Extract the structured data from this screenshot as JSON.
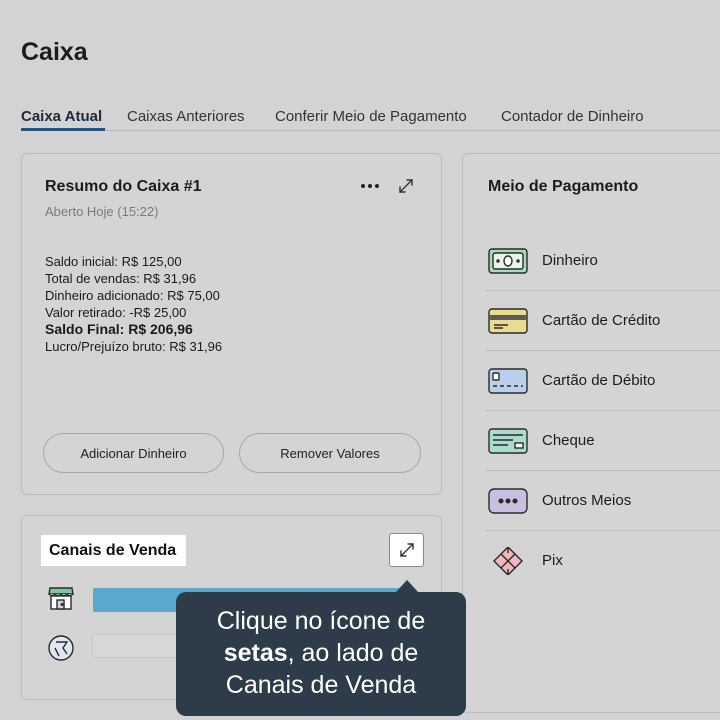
{
  "page": {
    "title": "Caixa"
  },
  "tabs": [
    {
      "label": "Caixa Atual",
      "active": true
    },
    {
      "label": "Caixas Anteriores",
      "active": false
    },
    {
      "label": "Conferir Meio de Pagamento",
      "active": false
    },
    {
      "label": "Contador de Dinheiro",
      "active": false
    }
  ],
  "resumo": {
    "title": "Resumo do Caixa #1",
    "subtitle": "Aberto Hoje (15:22)",
    "more_icon": "more-horizontal-icon",
    "expand_icon": "expand-arrows-icon",
    "lines": {
      "saldo_inicial": "Saldo inicial: R$ 125,00",
      "total_vendas": "Total de vendas: R$ 31,96",
      "dinheiro_adicionado": "Dinheiro adicionado: R$ 75,00",
      "valor_retirado": "Valor retirado: -R$ 25,00",
      "saldo_final": "Saldo Final: R$ 206,96",
      "lucro": "Lucro/Prejuízo bruto: R$ 31,96"
    },
    "add_button": "Adicionar Dinheiro",
    "remove_button": "Remover Valores"
  },
  "canais": {
    "title": "Canais de Venda",
    "expand_icon": "expand-arrows-icon",
    "channels": [
      {
        "icon": "store-icon",
        "bar_fill": 1.0,
        "bar_color": "#5aa9cc"
      },
      {
        "icon": "other-channel-icon",
        "bar_fill": 0.0,
        "bar_color": "#d7d7d7"
      }
    ]
  },
  "meio": {
    "title": "Meio de Pagamento",
    "items": [
      {
        "label": "Dinheiro",
        "icon": "cash-icon"
      },
      {
        "label": "Cartão de Crédito",
        "icon": "credit-card-icon"
      },
      {
        "label": "Cartão de Débito",
        "icon": "debit-card-icon"
      },
      {
        "label": "Cheque",
        "icon": "check-icon"
      },
      {
        "label": "Outros Meios",
        "icon": "other-payment-icon"
      },
      {
        "label": "Pix",
        "icon": "pix-icon"
      }
    ]
  },
  "tooltip": {
    "line1": "Clique no ícone de",
    "bold": "setas",
    "line2_rest": ", ao lado de",
    "line3": "Canais de Venda"
  },
  "colors": {
    "overlay_bg": "#d3d3d3",
    "accent": "#24527f",
    "tooltip_bg": "#2e3c4a",
    "bar_fill": "#5aa9cc"
  }
}
